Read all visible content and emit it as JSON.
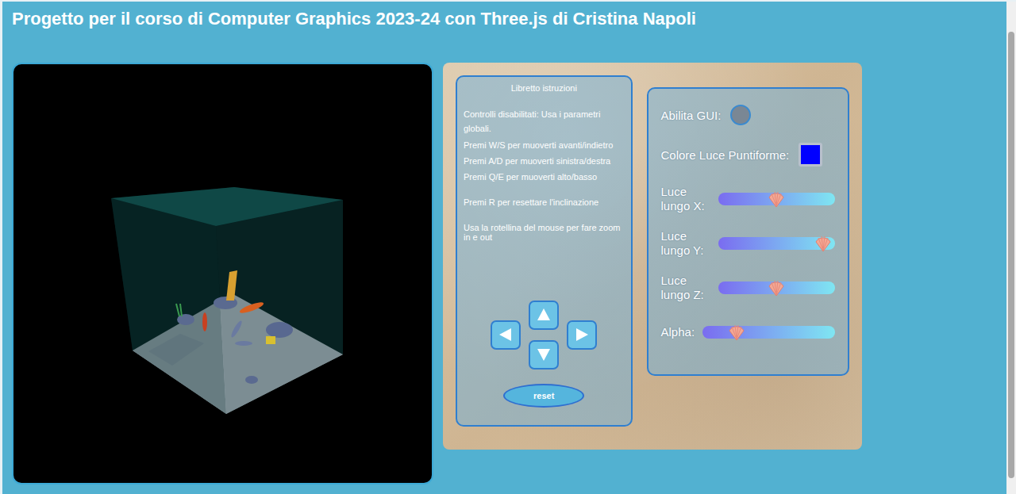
{
  "header": {
    "title": "Progetto per il corso di Computer Graphics 2023-24 con Three.js di Cristina Napoli"
  },
  "instructions": {
    "title": "Libretto istruzioni",
    "lines": [
      "Controlli disabilitati: Usa i parametri globali.",
      "Premi W/S per muoverti avanti/indietro",
      "Premi A/D per muoverti sinistra/destra",
      "Premi Q/E per muoverti alto/basso",
      "Premi R per resettare l'inclinazione",
      "Usa la rotellina del mouse per fare zoom in e out"
    ]
  },
  "controls": {
    "arrows": [
      {
        "kind": "up"
      },
      {
        "kind": "left"
      },
      {
        "kind": "right"
      },
      {
        "kind": "down"
      }
    ],
    "reset": "reset"
  },
  "gui": {
    "toggle": {
      "label": "Abilita GUI:",
      "on": false
    },
    "light_color": {
      "label": "Colore Luce Puntiforme:",
      "color": "#0000ff"
    },
    "sliders": [
      {
        "label": "Luce lungo X:",
        "level": 0.5
      },
      {
        "label": "Luce lungo Y:",
        "level": 0.9
      },
      {
        "label": "Luce lungo Z:",
        "level": 0.5
      },
      {
        "label": "Alpha:",
        "level": 0.26
      }
    ]
  }
}
